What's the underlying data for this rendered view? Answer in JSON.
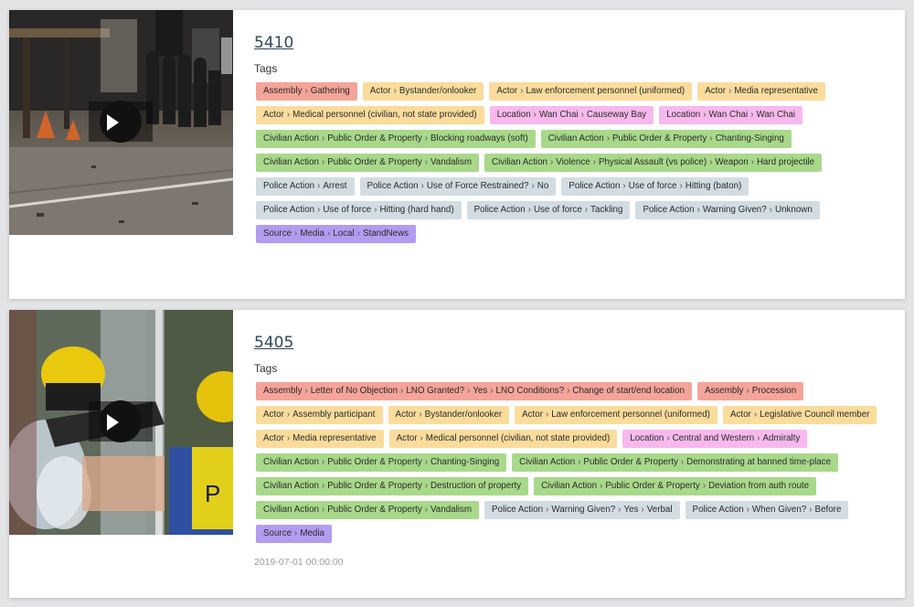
{
  "records": [
    {
      "id": "5410",
      "tags_label": "Tags",
      "date": "",
      "tags": [
        {
          "cat": "assembly",
          "parts": [
            "Assembly",
            "Gathering"
          ]
        },
        {
          "cat": "actor",
          "parts": [
            "Actor",
            "Bystander/onlooker"
          ]
        },
        {
          "cat": "actor",
          "parts": [
            "Actor",
            "Law enforcement personnel (uniformed)"
          ]
        },
        {
          "cat": "actor",
          "parts": [
            "Actor",
            "Media representative"
          ]
        },
        {
          "cat": "actor",
          "parts": [
            "Actor",
            "Medical personnel (civilian, not state provided)"
          ]
        },
        {
          "cat": "location",
          "parts": [
            "Location",
            "Wan Chai",
            "Causeway Bay"
          ]
        },
        {
          "cat": "location",
          "parts": [
            "Location",
            "Wan Chai",
            "Wan Chai"
          ]
        },
        {
          "cat": "civilian",
          "parts": [
            "Civilian Action",
            "Public Order & Property",
            "Blocking roadways (soft)"
          ]
        },
        {
          "cat": "civilian",
          "parts": [
            "Civilian Action",
            "Public Order & Property",
            "Chanting-Singing"
          ]
        },
        {
          "cat": "civilian",
          "parts": [
            "Civilian Action",
            "Public Order & Property",
            "Vandalism"
          ]
        },
        {
          "cat": "civilian",
          "parts": [
            "Civilian Action",
            "Violence",
            "Physical Assault (vs police)",
            "Weapon",
            "Hard projectile"
          ]
        },
        {
          "cat": "police",
          "parts": [
            "Police Action",
            "Arrest"
          ]
        },
        {
          "cat": "police",
          "parts": [
            "Police Action",
            "Use of Force Restrained?",
            "No"
          ]
        },
        {
          "cat": "police",
          "parts": [
            "Police Action",
            "Use of force",
            "Hitting (baton)"
          ]
        },
        {
          "cat": "police",
          "parts": [
            "Police Action",
            "Use of force",
            "Hitting (hard hand)"
          ]
        },
        {
          "cat": "police",
          "parts": [
            "Police Action",
            "Use of force",
            "Tackling"
          ]
        },
        {
          "cat": "police",
          "parts": [
            "Police Action",
            "Warning Given?",
            "Unknown"
          ]
        },
        {
          "cat": "source",
          "parts": [
            "Source",
            "Media",
            "Local",
            "StandNews"
          ]
        }
      ]
    },
    {
      "id": "5405",
      "tags_label": "Tags",
      "date": "2019-07-01 00:00:00",
      "tags": [
        {
          "cat": "assembly",
          "parts": [
            "Assembly",
            "Letter of No Objection",
            "LNO Granted?",
            "Yes",
            "LNO Conditions?",
            "Change of start/end location"
          ]
        },
        {
          "cat": "assembly",
          "parts": [
            "Assembly",
            "Procession"
          ]
        },
        {
          "cat": "actor",
          "parts": [
            "Actor",
            "Assembly participant"
          ]
        },
        {
          "cat": "actor",
          "parts": [
            "Actor",
            "Bystander/onlooker"
          ]
        },
        {
          "cat": "actor",
          "parts": [
            "Actor",
            "Law enforcement personnel (uniformed)"
          ]
        },
        {
          "cat": "actor",
          "parts": [
            "Actor",
            "Legislative Council member"
          ]
        },
        {
          "cat": "actor",
          "parts": [
            "Actor",
            "Media representative"
          ]
        },
        {
          "cat": "actor",
          "parts": [
            "Actor",
            "Medical personnel (civilian, not state provided)"
          ]
        },
        {
          "cat": "location",
          "parts": [
            "Location",
            "Central and Western",
            "Admiralty"
          ]
        },
        {
          "cat": "civilian",
          "parts": [
            "Civilian Action",
            "Public Order & Property",
            "Chanting-Singing"
          ]
        },
        {
          "cat": "civilian",
          "parts": [
            "Civilian Action",
            "Public Order & Property",
            "Demonstrating at banned time-place"
          ]
        },
        {
          "cat": "civilian",
          "parts": [
            "Civilian Action",
            "Public Order & Property",
            "Destruction of property"
          ]
        },
        {
          "cat": "civilian",
          "parts": [
            "Civilian Action",
            "Public Order & Property",
            "Deviation from auth route"
          ]
        },
        {
          "cat": "civilian",
          "parts": [
            "Civilian Action",
            "Public Order & Property",
            "Vandalism"
          ]
        },
        {
          "cat": "police",
          "parts": [
            "Police Action",
            "Warning Given?",
            "Yes",
            "Verbal"
          ]
        },
        {
          "cat": "police",
          "parts": [
            "Police Action",
            "When Given?",
            "Before"
          ]
        },
        {
          "cat": "source",
          "parts": [
            "Source",
            "Media"
          ]
        }
      ]
    }
  ],
  "icons": {
    "play": "play-icon",
    "separator": "chevron-right-separator"
  },
  "colors": {
    "assembly": "#f4a499",
    "actor": "#fbdc9c",
    "location": "#f7b9ec",
    "civilian": "#a8d98a",
    "police": "#d2dde3",
    "source": "#b29cf0",
    "link": "#2f4858"
  }
}
